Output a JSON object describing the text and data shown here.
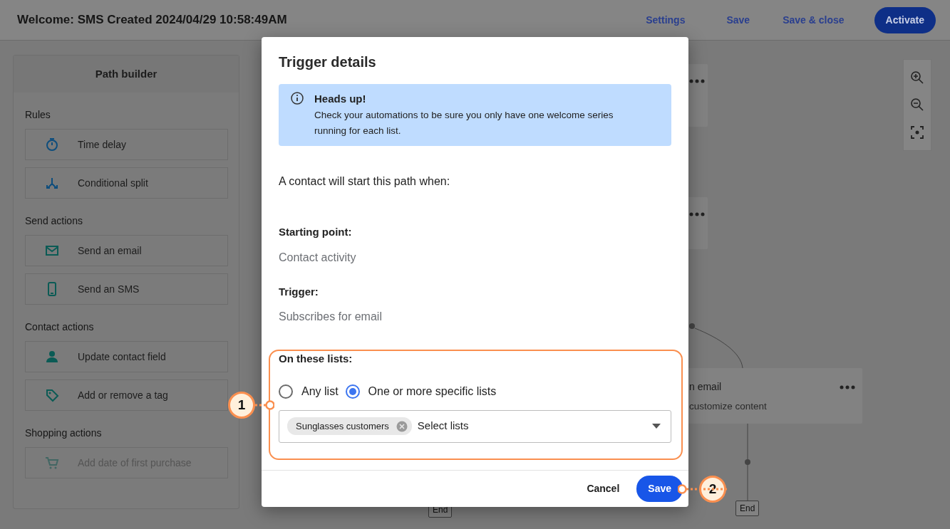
{
  "header": {
    "title": "Welcome: SMS Created 2024/04/29 10:58:49AM",
    "links": [
      "Settings",
      "Save",
      "Save & close"
    ],
    "primary_button": "Activate"
  },
  "sidebar": {
    "title": "Path builder",
    "sections": [
      {
        "title": "Rules",
        "items": [
          {
            "label": "Time delay",
            "disabled": false
          },
          {
            "label": "Conditional split",
            "disabled": false
          }
        ]
      },
      {
        "title": "Send actions",
        "items": [
          {
            "label": "Send an email",
            "disabled": false
          },
          {
            "label": "Send an SMS",
            "disabled": false
          }
        ]
      },
      {
        "title": "Contact actions",
        "items": [
          {
            "label": "Update contact field",
            "disabled": false
          },
          {
            "label": "Add or remove a tag",
            "disabled": false
          }
        ]
      },
      {
        "title": "Shopping actions",
        "items": [
          {
            "label": "Add date of first purchase",
            "disabled": true
          }
        ]
      }
    ]
  },
  "canvas": {
    "nodes": [
      {
        "kind": "stub"
      },
      {
        "kind": "stub"
      },
      {
        "kind": "card",
        "title": "n email",
        "subtitle": "customize content"
      }
    ],
    "end_labels": [
      "End",
      "End"
    ]
  },
  "modal": {
    "title": "Trigger details",
    "alert": {
      "title": "Heads up!",
      "text": "Check your automations to be sure you only have one welcome series running for each list."
    },
    "intro": "A contact will start this path when:",
    "fields": [
      {
        "label": "Starting point:",
        "value": "Contact activity"
      },
      {
        "label": "Trigger:",
        "value": "Subscribes for email"
      }
    ],
    "lists": {
      "label": "On these lists:",
      "options": [
        {
          "label": "Any list",
          "selected": false
        },
        {
          "label": "One or more specific lists",
          "selected": true
        }
      ],
      "tags": [
        "Sunglasses customers"
      ],
      "placeholder": "Select lists"
    },
    "buttons": {
      "cancel": "Cancel",
      "save": "Save"
    }
  },
  "callouts": [
    {
      "number": "1"
    },
    {
      "number": "2"
    }
  ]
}
